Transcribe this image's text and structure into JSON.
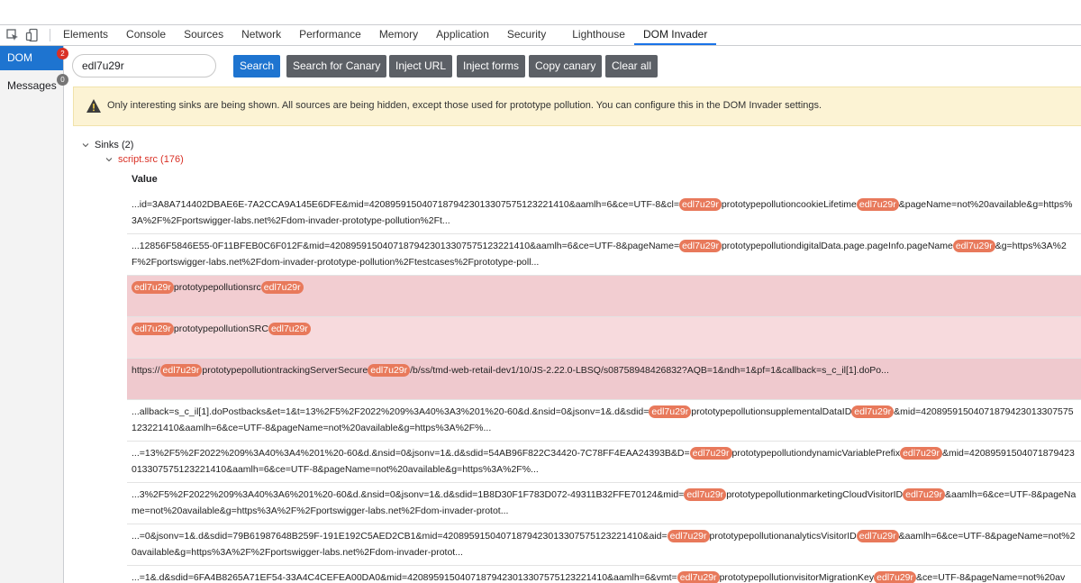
{
  "devtools": {
    "tabs": [
      "Elements",
      "Console",
      "Sources",
      "Network",
      "Performance",
      "Memory",
      "Application",
      "Security",
      "Lighthouse",
      "DOM Invader"
    ],
    "active_tab": "DOM Invader"
  },
  "sidebar": {
    "items": [
      {
        "label": "DOM",
        "badge": "2",
        "badge_color": "#d93025",
        "active": true
      },
      {
        "label": "Messages",
        "badge": "0",
        "badge_color": "#757575",
        "active": false
      }
    ]
  },
  "toolbar": {
    "search_value": "edl7u29r",
    "search_label": "Search",
    "search_canary_label": "Search for Canary",
    "inject_url_label": "Inject URL",
    "inject_forms_label": "Inject forms",
    "copy_canary_label": "Copy canary",
    "clear_all_label": "Clear all"
  },
  "warning": {
    "icon": "warning-triangle-icon",
    "text": "Only interesting sinks are being shown. All sources are being hidden, except those used for prototype pollution. You can configure this in the DOM Invader settings."
  },
  "tree": {
    "sinks_label": "Sinks (2)",
    "sink_label": "script.src (176)",
    "value_header": "Value"
  },
  "canary": "edl7u29r",
  "colors": {
    "accent": "#1e74d0",
    "canary": "#e8795b",
    "sink_text": "#d93025",
    "warning_bg": "#fcf3d4"
  },
  "rows": [
    {
      "style": "",
      "parts": [
        {
          "t": "...id=3A8A714402DBAE6E-7A2CCA9A145E6DFE&mid=42089591504071879423013307575123221410&aamlh=6&ce=UTF-8&cl="
        },
        {
          "c": "edl7u29r"
        },
        {
          "t": "prototypepollutioncookieLifetime"
        },
        {
          "c": "edl7u29r"
        },
        {
          "t": "&pageName=not%20available&g=https%3A%2F%2Fportswigger-labs.net%2Fdom-invader-prototype-pollution%2Ft..."
        }
      ]
    },
    {
      "style": "",
      "parts": [
        {
          "t": "...12856F5846E55-0F11BFEB0C6F012F&mid=42089591504071879423013307575123221410&aamlh=6&ce=UTF-8&pageName="
        },
        {
          "c": "edl7u29r"
        },
        {
          "t": "prototypepollutiondigitalData.page.pageInfo.pageName"
        },
        {
          "c": "edl7u29r"
        },
        {
          "t": "&g=https%3A%2F%2Fportswigger-labs.net%2Fdom-invader-prototype-pollution%2Ftestcases%2Fprototype-poll..."
        }
      ]
    },
    {
      "style": "hl-a",
      "parts": [
        {
          "c": "edl7u29r"
        },
        {
          "t": "prototypepollutionsrc"
        },
        {
          "c": "edl7u29r"
        }
      ]
    },
    {
      "style": "hl-b",
      "parts": [
        {
          "c": "edl7u29r"
        },
        {
          "t": "prototypepollutionSRC"
        },
        {
          "c": "edl7u29r"
        }
      ]
    },
    {
      "style": "hl-c",
      "parts": [
        {
          "t": "https://"
        },
        {
          "c": "edl7u29r"
        },
        {
          "t": "prototypepollutiontrackingServerSecure"
        },
        {
          "c": "edl7u29r"
        },
        {
          "t": "/b/ss/tmd-web-retail-dev1/10/JS-2.22.0-LBSQ/s08758948426832?AQB=1&ndh=1&pf=1&callback=s_c_il[1].doPo..."
        }
      ]
    },
    {
      "style": "",
      "parts": [
        {
          "t": "...allback=s_c_il[1].doPostbacks&et=1&t=13%2F5%2F2022%209%3A40%3A3%201%20-60&d.&nsid=0&jsonv=1&.d&sdid="
        },
        {
          "c": "edl7u29r"
        },
        {
          "t": "prototypepollutionsupplementalDataID"
        },
        {
          "c": "edl7u29r"
        },
        {
          "t": "&mid=42089591504071879423013307575123221410&aamlh=6&ce=UTF-8&pageName=not%20available&g=https%3A%2F%..."
        }
      ]
    },
    {
      "style": "",
      "parts": [
        {
          "t": "...=13%2F5%2F2022%209%3A40%3A4%201%20-60&d.&nsid=0&jsonv=1&.d&sdid=54AB96F822C34420-7C78FF4EAA24393B&D="
        },
        {
          "c": "edl7u29r"
        },
        {
          "t": "prototypepollutiondynamicVariablePrefix"
        },
        {
          "c": "edl7u29r"
        },
        {
          "t": "&mid=42089591504071879423013307575123221410&aamlh=6&ce=UTF-8&pageName=not%20available&g=https%3A%2F%..."
        }
      ]
    },
    {
      "style": "",
      "parts": [
        {
          "t": "...3%2F5%2F2022%209%3A40%3A6%201%20-60&d.&nsid=0&jsonv=1&.d&sdid=1B8D30F1F783D072-49311B32FFE70124&mid="
        },
        {
          "c": "edl7u29r"
        },
        {
          "t": "prototypepollutionmarketingCloudVisitorID"
        },
        {
          "c": "edl7u29r"
        },
        {
          "t": "&aamlh=6&ce=UTF-8&pageName=not%20available&g=https%3A%2F%2Fportswigger-labs.net%2Fdom-invader-protot..."
        }
      ]
    },
    {
      "style": "",
      "parts": [
        {
          "t": "...=0&jsonv=1&.d&sdid=79B61987648B259F-191E192C5AED2CB1&mid=42089591504071879423013307575123221410&aid="
        },
        {
          "c": "edl7u29r"
        },
        {
          "t": "prototypepollutionanalyticsVisitorID"
        },
        {
          "c": "edl7u29r"
        },
        {
          "t": "&aamlh=6&ce=UTF-8&pageName=not%20available&g=https%3A%2F%2Fportswigger-labs.net%2Fdom-invader-protot..."
        }
      ]
    },
    {
      "style": "",
      "parts": [
        {
          "t": "...=1&.d&sdid=6FA4B8265A71EF54-33A4C4CEFEA00DA0&mid=42089591504071879423013307575123221410&aamlh=6&vmt="
        },
        {
          "c": "edl7u29r"
        },
        {
          "t": "prototypepollutionvisitorMigrationKey"
        },
        {
          "c": "edl7u29r"
        },
        {
          "t": "&ce=UTF-8&pageName=not%20av"
        }
      ]
    }
  ]
}
